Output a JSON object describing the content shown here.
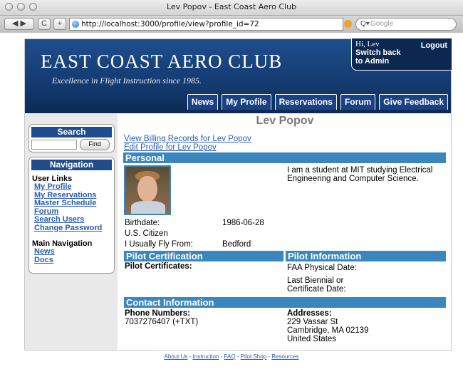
{
  "browser": {
    "window_title": "Lev Popov - East Coast Aero Club",
    "url": "http://localhost:3000/profile/view?profile_id=72",
    "search_placeholder": "Google",
    "nav_glyphs": {
      "back_forward": "◀ ▶",
      "reload": "C",
      "add": "+"
    }
  },
  "header": {
    "club_name": "EAST COAST AERO CLUB",
    "tagline": "Excellence in Flight Instruction since 1985.",
    "greeting": "Hi, Lev",
    "switch_back": "Switch back to Admin",
    "logout": "Logout",
    "tabs": [
      "News",
      "My Profile",
      "Reservations",
      "Forum",
      "Give Feedback"
    ]
  },
  "sidebar": {
    "search_title": "Search",
    "find_button": "Find",
    "nav_title": "Navigation",
    "user_links_heading": "User Links",
    "user_links": [
      "My Profile",
      "My Reservations",
      "Master Schedule",
      "Forum",
      "Search Users",
      "Change Password"
    ],
    "main_nav_heading": "Main Navigation",
    "main_nav_links": [
      "News",
      "Docs"
    ]
  },
  "profile": {
    "name": "Lev Popov",
    "billing_link": "View Billing Records for Lev Popov",
    "edit_link": "Edit Profile for Lev Popov",
    "personal_title": "Personal",
    "bio": "I am a student at MIT studying Electrical Engineering and Computer Science.",
    "birthdate_label": "Birthdate:",
    "birthdate": "1986-06-28",
    "citizenship": "U.S. Citizen",
    "fly_from_label": "I Usually Fly From:",
    "fly_from": "Bedford",
    "pilot_cert_title": "Pilot Certification",
    "pilot_certificates_label": "Pilot Certificates:",
    "pilot_info_title": "Pilot Information",
    "faa_physical_label": "FAA Physical Date:",
    "biennial_label": "Last Biennial or Certificate Date:",
    "contact_title": "Contact Information",
    "phone_label": "Phone Numbers:",
    "phone": "7037276407 (+TXT)",
    "address_label": "Addresses:",
    "address_lines": [
      "229 Vassar St",
      "Cambridge, MA 02139",
      "United States"
    ]
  },
  "footer": {
    "links": [
      "About Us",
      "Instruction",
      "FAQ",
      "Pilot Shop",
      "Resources"
    ],
    "separator": " - "
  },
  "colors": {
    "banner": "#12376b",
    "section_bar": "#3c86c0",
    "link": "#2a5db0",
    "sidebar_bg": "#e9e9e9"
  }
}
